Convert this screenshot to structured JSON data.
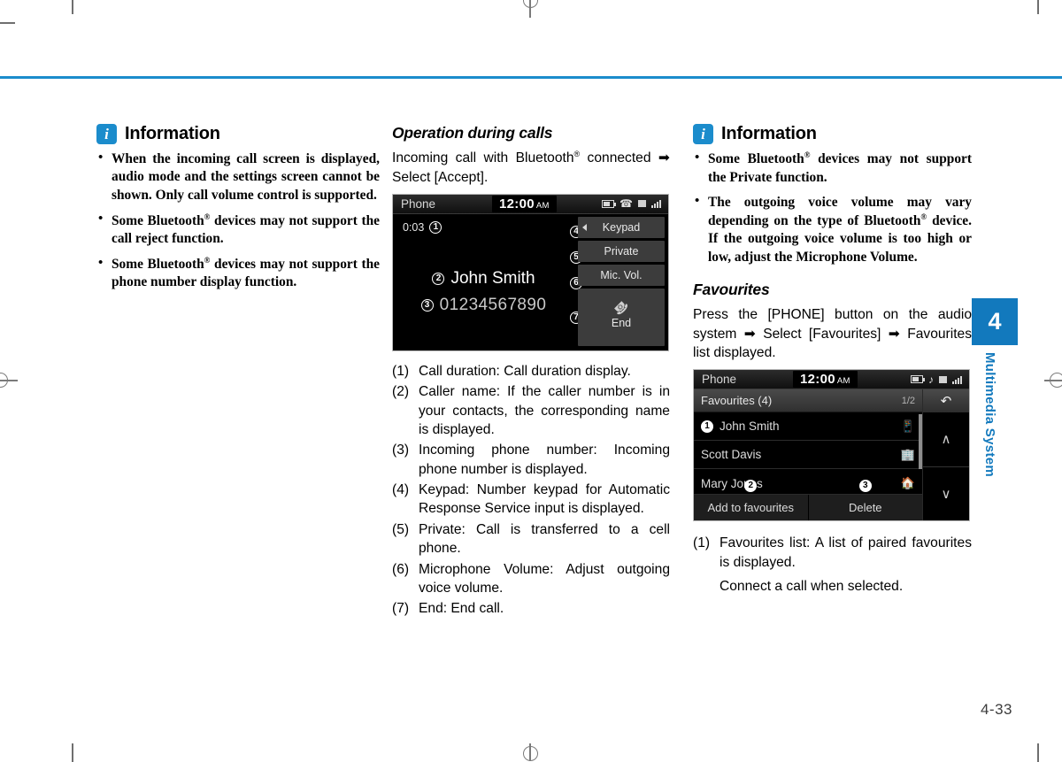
{
  "page": {
    "number": "4-33",
    "side_tab_number": "4",
    "side_tab_label": "Multimedia System"
  },
  "left_column": {
    "info": {
      "badge": "i",
      "title": "Information",
      "items": [
        "When the incoming call screen is displayed, audio mode and the settings screen cannot be shown. Only call volume control is supported.",
        "Some Bluetooth® devices may not support the call reject function.",
        "Some Bluetooth® devices may not support the phone number display function."
      ]
    }
  },
  "middle_column": {
    "section_title": "Operation during calls",
    "intro": "Incoming call with Bluetooth® connected ➡ Select [Accept].",
    "call_screen": {
      "status": {
        "title": "Phone",
        "clock": "12:00",
        "ampm": "AM",
        "icons": [
          "battery-icon",
          "bluetooth-phone-icon",
          "signal-icon"
        ]
      },
      "call_duration": "0:03",
      "caller_name": "John Smith",
      "caller_number": "01234567890",
      "buttons": [
        {
          "marker": "4",
          "label": "Keypad"
        },
        {
          "marker": "5",
          "label": "Private"
        },
        {
          "marker": "6",
          "label": "Mic. Vol."
        },
        {
          "marker": "7",
          "label": "End"
        }
      ],
      "markers": {
        "duration": "1",
        "name": "2",
        "number": "3"
      }
    },
    "legend": [
      {
        "num": "(1)",
        "text": "Call duration: Call duration display."
      },
      {
        "num": "(2)",
        "text": "Caller name: If the caller number is in your contacts, the corresponding name is displayed."
      },
      {
        "num": "(3)",
        "text": "Incoming phone number: Incoming phone number is displayed."
      },
      {
        "num": "(4)",
        "text": "Keypad: Number keypad for Automatic Response Service input is displayed."
      },
      {
        "num": "(5)",
        "text": "Private: Call is transferred to a cell phone."
      },
      {
        "num": "(6)",
        "text": "Microphone Volume: Adjust outgoing voice volume."
      },
      {
        "num": "(7)",
        "text": "End: End call."
      }
    ]
  },
  "right_column": {
    "info": {
      "badge": "i",
      "title": "Information",
      "items": [
        "Some Bluetooth® devices may not support the Private function.",
        "The outgoing voice volume may vary depending on the type of Bluetooth® device. If the outgoing voice volume is too high or low, adjust the Microphone Volume."
      ]
    },
    "section_title": "Favourites",
    "intro": "Press the [PHONE] button on the audio system ➡ Select [Favourites] ➡ Favourites list displayed.",
    "fav_screen": {
      "status": {
        "title": "Phone",
        "clock": "12:00",
        "ampm": "AM",
        "icons": [
          "battery-icon",
          "mute-note-icon",
          "bluetooth-signal-icon"
        ]
      },
      "list_header": "Favourites (4)",
      "page_indicator": "1/2",
      "rows": [
        {
          "marker": "1",
          "name": "John Smith",
          "icon": "mobile-phone-icon"
        },
        {
          "marker": "",
          "name": "Scott Davis",
          "icon": "office-building-icon"
        },
        {
          "marker": "",
          "name": "Mary Jones",
          "icon": "home-icon"
        }
      ],
      "bottom_buttons": [
        {
          "marker": "2",
          "label": "Add to favourites"
        },
        {
          "marker": "3",
          "label": "Delete"
        }
      ],
      "back_icon": "back-arrow-icon",
      "scroll_up_icon": "chevron-up-icon",
      "scroll_down_icon": "chevron-down-icon"
    },
    "legend": [
      {
        "num": "(1)",
        "text": "Favourites list: A list of paired favourites is displayed."
      }
    ],
    "legend_sub": "Connect a call when selected."
  },
  "theme": {
    "accent": "#1b8ccc",
    "tab_blue": "#1279bd",
    "screen_bg": "#000000"
  }
}
